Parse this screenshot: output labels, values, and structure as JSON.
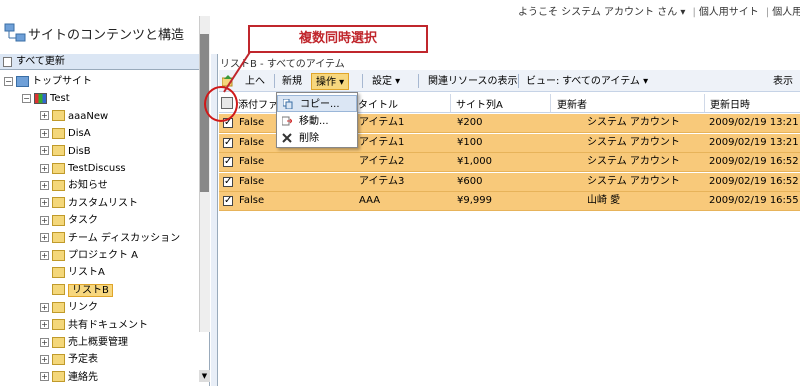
{
  "header": {
    "welcome": "ようこそ システム アカウント さん ▾",
    "my_site": "個人用サイト",
    "my_links": "個人用リンク ▾",
    "site_title": "サイトのコンテンツと構造"
  },
  "annotation": {
    "callout_text": "複数同時選択"
  },
  "nav": {
    "header": "すべて更新",
    "items": [
      {
        "label": "トップサイト",
        "expander": "−"
      },
      {
        "label": "Test",
        "expander": "−"
      },
      {
        "label": "aaaNew",
        "expander": "+"
      },
      {
        "label": "DisA",
        "expander": "+"
      },
      {
        "label": "DisB",
        "expander": "+"
      },
      {
        "label": "TestDiscuss",
        "expander": "+"
      },
      {
        "label": "お知らせ",
        "expander": "+"
      },
      {
        "label": "カスタムリスト",
        "expander": "+"
      },
      {
        "label": "タスク",
        "expander": "+"
      },
      {
        "label": "チーム ディスカッション",
        "expander": "+"
      },
      {
        "label": "プロジェクト A",
        "expander": "+"
      },
      {
        "label": "リストA",
        "expander": ""
      },
      {
        "label": "リストB",
        "expander": ""
      },
      {
        "label": "リンク",
        "expander": "+"
      },
      {
        "label": "共有ドキュメント",
        "expander": "+"
      },
      {
        "label": "売上概要管理",
        "expander": "+"
      },
      {
        "label": "予定表",
        "expander": "+"
      },
      {
        "label": "連絡先",
        "expander": "+"
      }
    ]
  },
  "main": {
    "breadcrumb": "リストB - すべてのアイテム",
    "toolbar": {
      "up": "上へ",
      "new": "新規",
      "actions": "操作 ▾",
      "settings": "設定 ▾",
      "related": "関連リソースの表示",
      "view_label": "ビュー:",
      "view_value": "すべてのアイテム ▾",
      "show": "表示"
    },
    "columns": [
      "添付ファ",
      "タイトル",
      "サイト列A",
      "更新者",
      "更新日時"
    ],
    "rows": [
      {
        "checked": "✓",
        "attach": "False",
        "title": "アイテム1",
        "col_a": "¥200",
        "modified_by": "システム アカウント",
        "modified": "2009/02/19 13:21"
      },
      {
        "checked": "✓",
        "attach": "False",
        "title": "アイテム1",
        "col_a": "¥100",
        "modified_by": "システム アカウント",
        "modified": "2009/02/19 13:21"
      },
      {
        "checked": "✓",
        "attach": "False",
        "title": "アイテム2",
        "col_a": "¥1,000",
        "modified_by": "システム アカウント",
        "modified": "2009/02/19 16:52"
      },
      {
        "checked": "✓",
        "attach": "False",
        "title": "アイテム3",
        "col_a": "¥600",
        "modified_by": "システム アカウント",
        "modified": "2009/02/19 16:52"
      },
      {
        "checked": "✓",
        "attach": "False",
        "title": "AAA",
        "col_a": "¥9,999",
        "modified_by": "山崎 愛",
        "modified": "2009/02/19 16:55"
      }
    ],
    "menu": {
      "copy": "コピー...",
      "move": "移動...",
      "delete": "削除"
    }
  },
  "colors": {
    "selected_row": "#f8c97a",
    "annotation_red": "#c0262c",
    "toolbar_bg": "#eef2f8"
  }
}
